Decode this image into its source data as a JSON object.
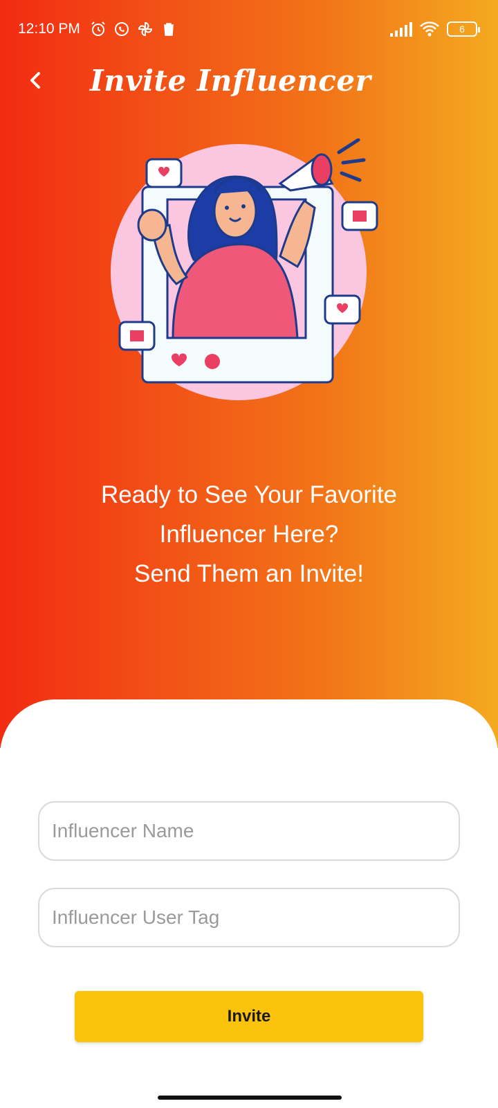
{
  "status_bar": {
    "time": "12:10 PM",
    "battery_level": "6",
    "left_icons": [
      "alarm-icon",
      "whatsapp-icon",
      "pinwheel-icon",
      "trash-icon"
    ],
    "right_icons": [
      "signal-icon",
      "wifi-icon",
      "battery-icon"
    ]
  },
  "app_bar": {
    "back_icon": "chevron-left-icon",
    "title": "Invite Influencer"
  },
  "illustration": {
    "icon": "influencer-megaphone-illustration"
  },
  "headline": {
    "line1": "Ready to See Your Favorite",
    "line2": "Influencer Here?",
    "line3": "Send Them an Invite!"
  },
  "form": {
    "name_field": {
      "value": "",
      "placeholder": "Influencer Name"
    },
    "tag_field": {
      "value": "",
      "placeholder": "Influencer User Tag"
    },
    "submit_label": "Invite"
  },
  "colors": {
    "gradient_start": "#f22b12",
    "gradient_end": "#f4aa20",
    "button": "#fcc30c",
    "field_border": "#dadada"
  }
}
